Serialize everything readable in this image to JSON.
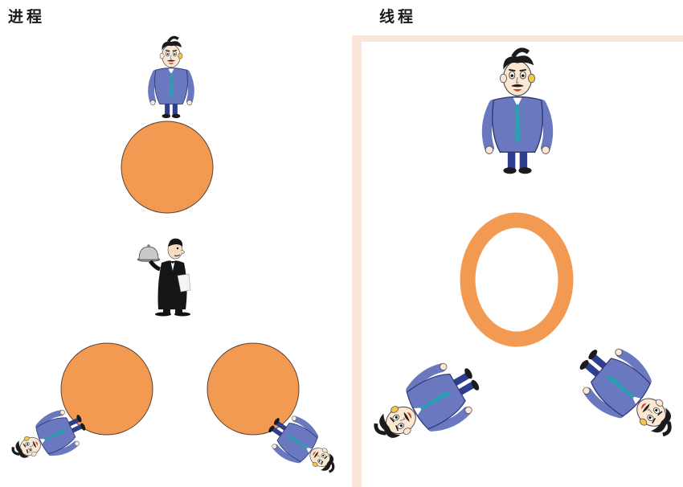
{
  "panels": {
    "left": {
      "title": "进程"
    },
    "right": {
      "title": "线程"
    }
  },
  "colors": {
    "resource_orange": "#f39a52",
    "resource_outline": "#5a4030",
    "suit_blue": "#6a78c0",
    "tie_teal": "#2a9fb0",
    "hair_dark": "#1b1b1b",
    "skin": "#fbe7d2",
    "frame_tint": "#fbe6dc"
  },
  "icons": {
    "person": "cartoon-man-icon",
    "waiter": "waiter-with-cloche-icon",
    "resource": "orange-circle",
    "shared_resource": "orange-ring"
  }
}
